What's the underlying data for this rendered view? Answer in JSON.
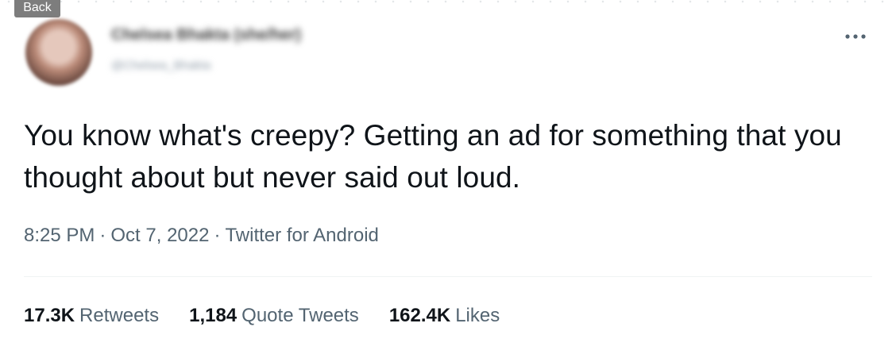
{
  "overlay": {
    "back_label": "Back"
  },
  "author": {
    "display_name": "Chelsea Bhakta (she/her)",
    "handle": "@Chelsea_Bhakta"
  },
  "tweet": {
    "text": "You know what's creepy? Getting an ad for something that you thought about but never said out loud.",
    "time": "8:25 PM",
    "date": "Oct 7, 2022",
    "source": "Twitter for Android"
  },
  "stats": {
    "retweets": {
      "count": "17.3K",
      "label": "Retweets"
    },
    "quotes": {
      "count": "1,184",
      "label": "Quote Tweets"
    },
    "likes": {
      "count": "162.4K",
      "label": "Likes"
    }
  },
  "icons": {
    "more": "more-horizontal-icon"
  },
  "colors": {
    "text": "#0f1419",
    "secondary": "#536471",
    "divider": "#eff3f4"
  }
}
